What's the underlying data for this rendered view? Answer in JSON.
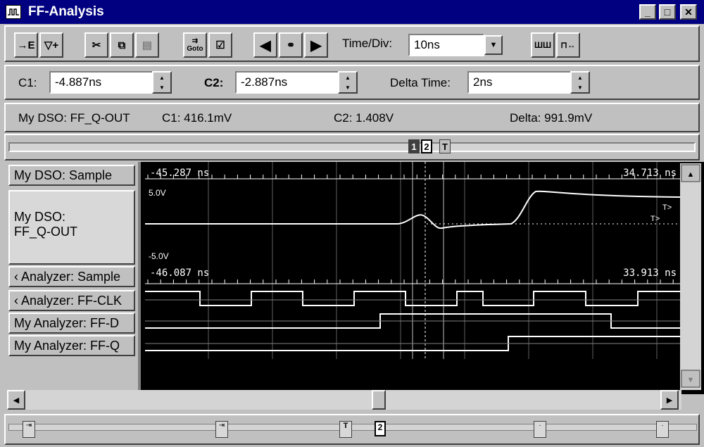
{
  "window": {
    "title": "FF-Analysis"
  },
  "toolbar": {
    "time_div_label": "Time/Div:",
    "time_div_value": "10ns",
    "goto_label": "Goto"
  },
  "cursors": {
    "c1_label": "C1:",
    "c1_value": "-4.887ns",
    "c2_label": "C2:",
    "c2_value": "-2.887ns",
    "delta_label": "Delta Time:",
    "delta_value": "2ns"
  },
  "readout": {
    "source": "My DSO: FF_Q-OUT",
    "c1": "C1: 416.1mV",
    "c2": "C2: 1.408V",
    "delta": "Delta:  991.9mV"
  },
  "markers": {
    "m1": "1",
    "m2": "2",
    "mt": "T"
  },
  "signals": [
    {
      "label": "My DSO: Sample"
    },
    {
      "label": "My DSO:\nFF_Q-OUT"
    },
    {
      "label": "‹ Analyzer: Sample"
    },
    {
      "label": "‹ Analyzer: FF-CLK"
    },
    {
      "label": "My Analyzer: FF-D"
    },
    {
      "label": "My Analyzer: FF-Q"
    }
  ],
  "waveform": {
    "dso_time_start": "-45.287 ns",
    "dso_time_end": "34.713 ns",
    "analyzer_time_start": "-46.087 ns",
    "analyzer_time_end": "33.913 ns",
    "v_top": "5.0V",
    "v_bottom": "-5.0V",
    "trig_marker_1": "T>",
    "trig_marker_2": "T>"
  },
  "colors": {
    "titlebar": "#000080",
    "trace": "#ffffff",
    "background": "#000000",
    "grid": "#808080"
  }
}
